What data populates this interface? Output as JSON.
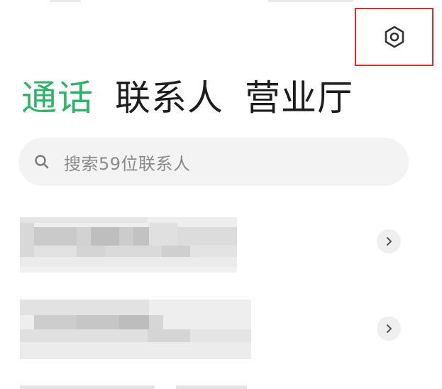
{
  "header": {
    "settings_icon": "hexagon-gear-icon",
    "highlight_color": "#d9302c"
  },
  "tabs": [
    {
      "label": "通话",
      "active": true
    },
    {
      "label": "联系人",
      "active": false
    },
    {
      "label": "营业厅",
      "active": false
    }
  ],
  "colors": {
    "accent": "#2fb36b",
    "text": "#1d1d1d",
    "search_bg": "#f3f3f3",
    "placeholder": "#8a8a8a"
  },
  "search": {
    "icon": "search-icon",
    "placeholder": "搜索59位联系人"
  },
  "contacts": [
    {
      "redacted": true,
      "trailing_icon": "chevron-right-icon"
    },
    {
      "redacted": true,
      "trailing_icon": "chevron-right-icon"
    }
  ]
}
